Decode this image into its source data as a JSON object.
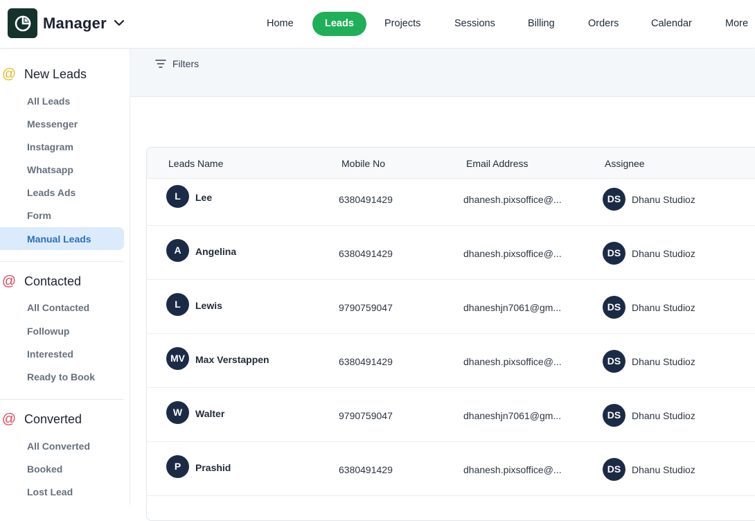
{
  "app": {
    "title": "Manager"
  },
  "nav": {
    "items": [
      "Home",
      "Leads",
      "Projects",
      "Sessions",
      "Billing",
      "Orders",
      "Calendar",
      "More"
    ],
    "active": "Leads"
  },
  "sidebar": {
    "groups": [
      {
        "title": "New Leads",
        "icon": "at-icon",
        "color": "#e8b820",
        "items": [
          "All Leads",
          "Messenger",
          "Instagram",
          "Whatsapp",
          "Leads Ads",
          "Form",
          "Manual Leads"
        ],
        "active": "Manual Leads"
      },
      {
        "title": "Contacted",
        "icon": "at-icon",
        "color": "#e0465c",
        "items": [
          "All Contacted",
          "Followup",
          "Interested",
          "Ready to Book"
        ]
      },
      {
        "title": "Converted",
        "icon": "at-icon",
        "color": "#e0465c",
        "items": [
          "All Converted",
          "Booked",
          "Lost Lead"
        ]
      }
    ]
  },
  "filter": {
    "label": "Filters"
  },
  "table": {
    "columns": [
      "Leads Name",
      "Mobile No",
      "Email Address",
      "Assignee"
    ],
    "rows": [
      {
        "initials": "L",
        "name": "Lee",
        "mobile": "6380491429",
        "email": "dhanesh.pixsoffice@...",
        "assignee_initials": "DS",
        "assignee": "Dhanu Studioz"
      },
      {
        "initials": "A",
        "name": "Angelina",
        "mobile": "6380491429",
        "email": "dhanesh.pixsoffice@...",
        "assignee_initials": "DS",
        "assignee": "Dhanu Studioz"
      },
      {
        "initials": "L",
        "name": "Lewis",
        "mobile": "9790759047",
        "email": "dhaneshjn7061@gm...",
        "assignee_initials": "DS",
        "assignee": "Dhanu Studioz"
      },
      {
        "initials": "MV",
        "name": "Max Verstappen",
        "mobile": "6380491429",
        "email": "dhanesh.pixsoffice@...",
        "assignee_initials": "DS",
        "assignee": "Dhanu Studioz"
      },
      {
        "initials": "W",
        "name": "Walter",
        "mobile": "9790759047",
        "email": "dhaneshjn7061@gm...",
        "assignee_initials": "DS",
        "assignee": "Dhanu Studioz"
      },
      {
        "initials": "P",
        "name": "Prashid",
        "mobile": "6380491429",
        "email": "dhanesh.pixsoffice@...",
        "assignee_initials": "DS",
        "assignee": "Dhanu Studioz"
      }
    ]
  },
  "colors": {
    "accent": "#1faf59",
    "avatar": "#1c2b45",
    "active_item_bg": "#dcebfb",
    "active_item_text": "#2a6fc0"
  }
}
